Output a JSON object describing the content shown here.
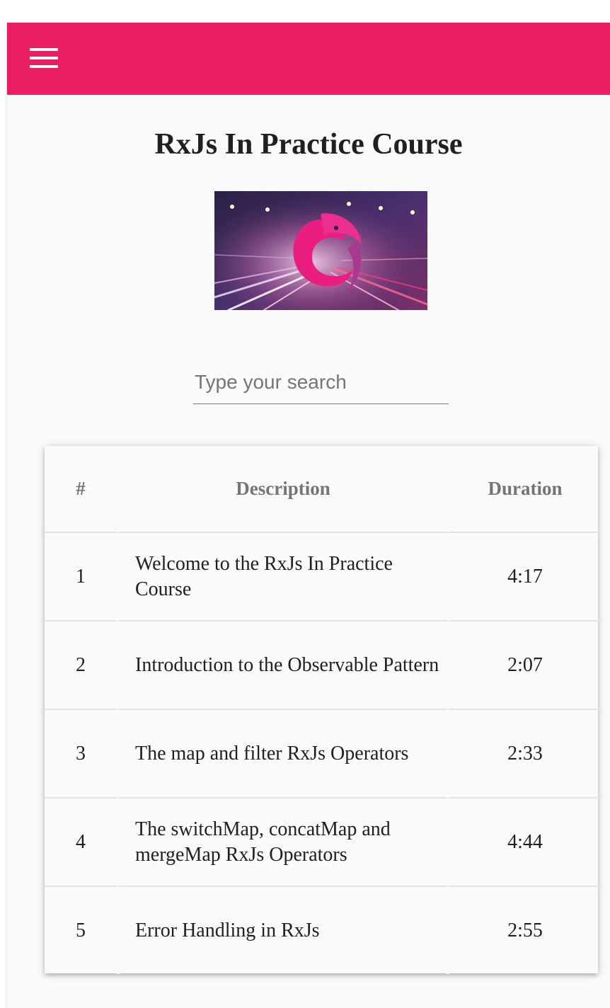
{
  "toolbar": {
    "menu_icon": "menu-icon",
    "color": "#e91e63"
  },
  "course": {
    "title": "RxJs In Practice Course",
    "image_alt": "rxjs-logo-on-city-lights"
  },
  "search": {
    "placeholder": "Type your search",
    "value": ""
  },
  "lessons_table": {
    "columns": [
      "#",
      "Description",
      "Duration"
    ],
    "rows": [
      {
        "num": "1",
        "description": "Welcome to the RxJs In Practice Course",
        "duration": "4:17"
      },
      {
        "num": "2",
        "description": "Introduction to the Observable Pattern",
        "duration": "2:07"
      },
      {
        "num": "3",
        "description": "The map and filter RxJs Operators",
        "duration": "2:33"
      },
      {
        "num": "4",
        "description": "The switchMap, concatMap and mergeMap RxJs Operators",
        "duration": "4:44"
      },
      {
        "num": "5",
        "description": "Error Handling in RxJs",
        "duration": "2:55"
      }
    ]
  }
}
